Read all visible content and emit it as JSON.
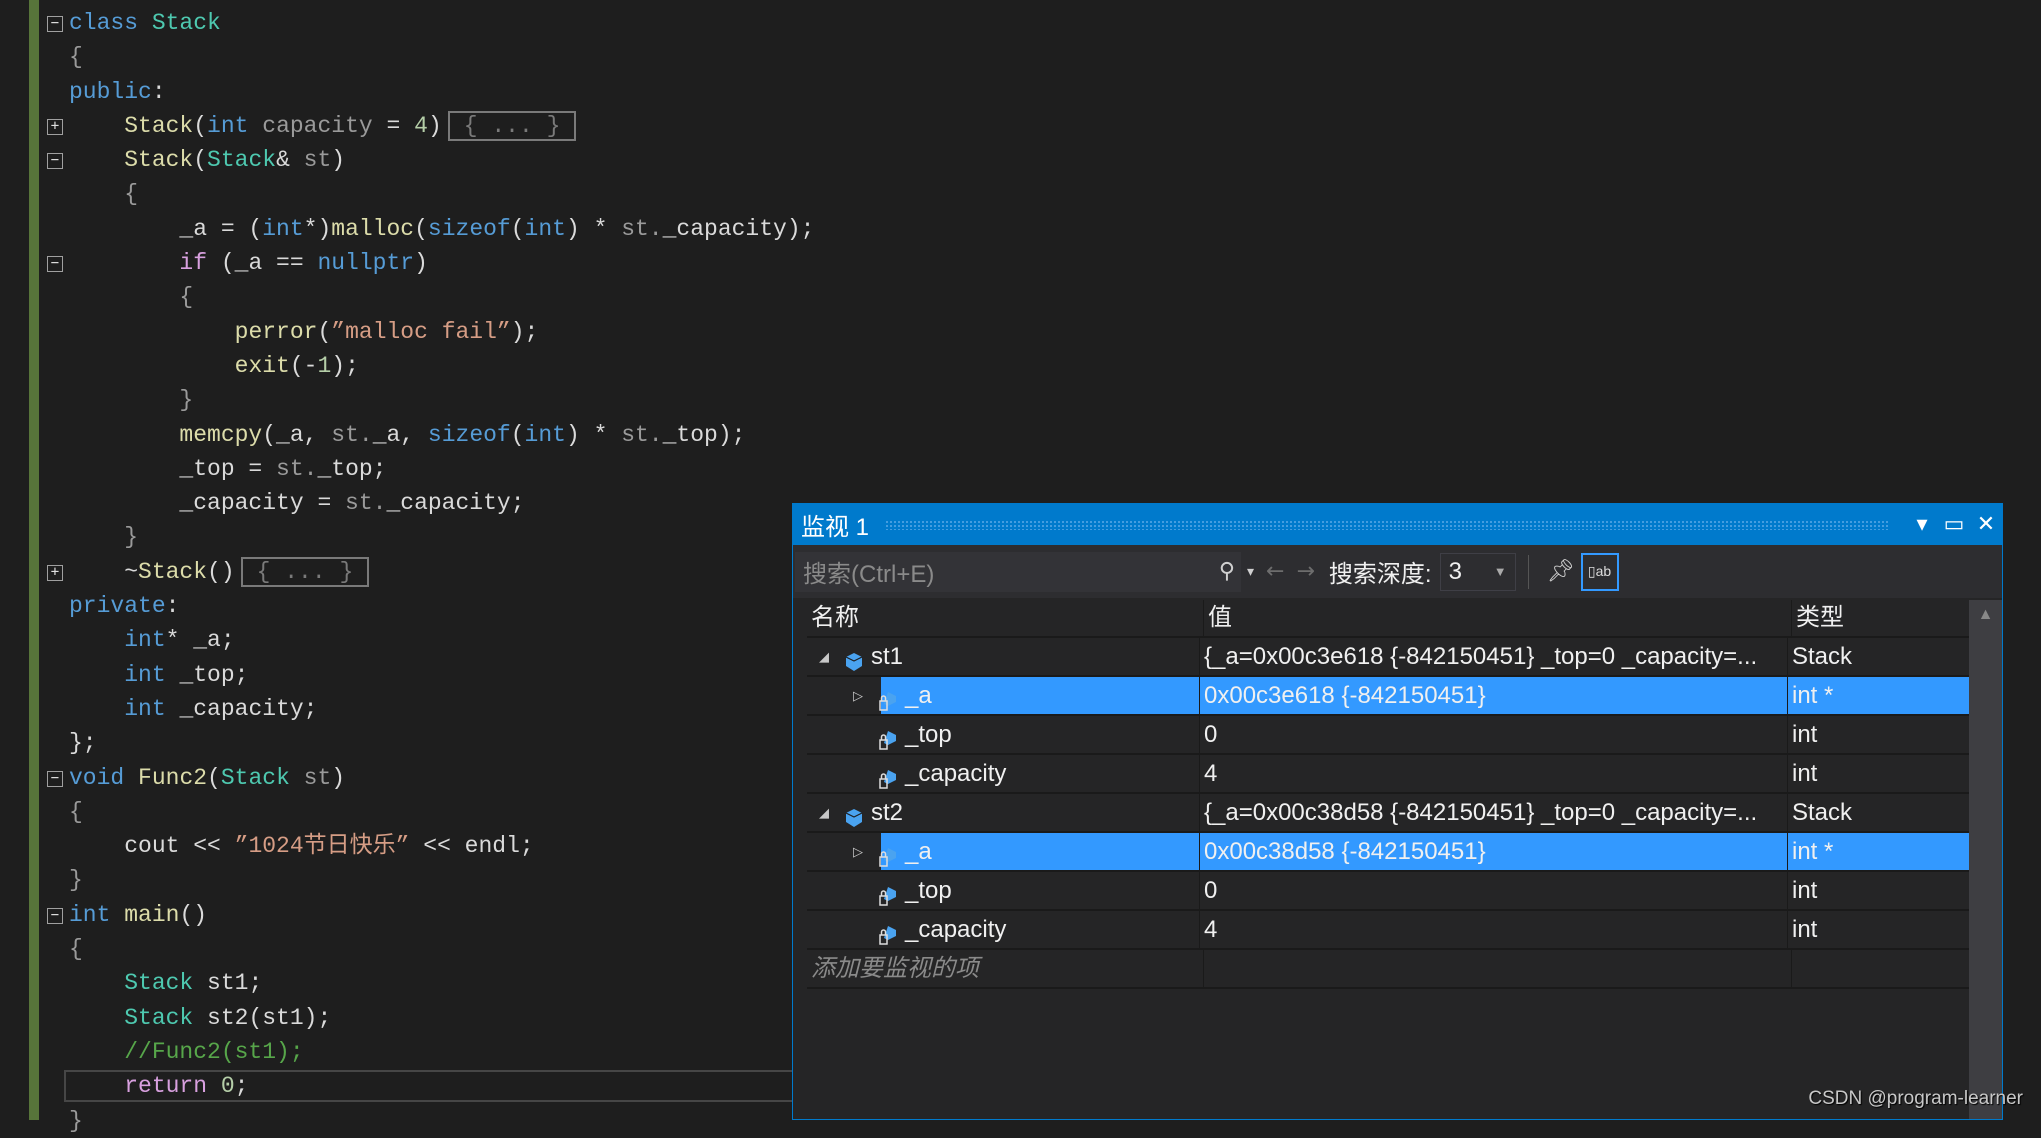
{
  "editor": {
    "lines": [
      {
        "fold": "minus",
        "tokens": [
          [
            "class",
            "kw"
          ],
          [
            " "
          ],
          [
            "Stack",
            "ty"
          ]
        ]
      },
      {
        "tokens": [
          [
            "{",
            "pm"
          ]
        ]
      },
      {
        "tokens": [
          [
            "public",
            "kw"
          ],
          [
            ":"
          ]
        ]
      },
      {
        "fold": "plus",
        "tokens": [
          [
            "    "
          ],
          [
            "Stack",
            "fn"
          ],
          [
            "("
          ],
          [
            "int",
            "kw"
          ],
          [
            " capacity",
            "pm"
          ],
          [
            " = "
          ],
          [
            "4",
            "nm"
          ],
          [
            ")"
          ]
        ],
        "collapsed": "{ ... }"
      },
      {
        "fold": "minus",
        "tokens": [
          [
            "    "
          ],
          [
            "Stack",
            "fn"
          ],
          [
            "("
          ],
          [
            "Stack",
            "ty"
          ],
          [
            "&"
          ],
          [
            " st",
            "pm"
          ],
          [
            ")"
          ]
        ]
      },
      {
        "tokens": [
          [
            "    {",
            "pm"
          ]
        ]
      },
      {
        "tokens": [
          [
            "        _a = ("
          ],
          [
            "int",
            "kw"
          ],
          [
            "*)"
          ],
          [
            "malloc",
            "fn"
          ],
          [
            "("
          ],
          [
            "sizeof",
            "kw"
          ],
          [
            "("
          ],
          [
            "int",
            "kw"
          ],
          [
            ") * "
          ],
          [
            "st.",
            "pm"
          ],
          [
            "_capacity);"
          ]
        ]
      },
      {
        "fold": "minus",
        "tokens": [
          [
            "        "
          ],
          [
            "if",
            "ct"
          ],
          [
            " (_a == "
          ],
          [
            "nullptr",
            "kw"
          ],
          [
            ")"
          ]
        ]
      },
      {
        "tokens": [
          [
            "        {",
            "pm"
          ]
        ]
      },
      {
        "tokens": [
          [
            "            "
          ],
          [
            "perror",
            "fn"
          ],
          [
            "("
          ],
          [
            "”malloc fail”",
            "st"
          ],
          [
            ");"
          ]
        ]
      },
      {
        "tokens": [
          [
            "            "
          ],
          [
            "exit",
            "fn"
          ],
          [
            "(-"
          ],
          [
            "1",
            "nm"
          ],
          [
            ");"
          ]
        ]
      },
      {
        "tokens": [
          [
            "        }",
            "pm"
          ]
        ]
      },
      {
        "tokens": [
          [
            "        "
          ],
          [
            "memcpy",
            "fn"
          ],
          [
            "(_a, "
          ],
          [
            "st.",
            "pm"
          ],
          [
            "_a, "
          ],
          [
            "sizeof",
            "kw"
          ],
          [
            "("
          ],
          [
            "int",
            "kw"
          ],
          [
            ") * "
          ],
          [
            "st.",
            "pm"
          ],
          [
            "_top);"
          ]
        ]
      },
      {
        "tokens": [
          [
            "        _top = "
          ],
          [
            "st.",
            "pm"
          ],
          [
            "_top;"
          ]
        ]
      },
      {
        "tokens": [
          [
            "        _capacity = "
          ],
          [
            "st.",
            "pm"
          ],
          [
            "_capacity;"
          ]
        ]
      },
      {
        "tokens": [
          [
            "    }",
            "pm"
          ]
        ]
      },
      {
        "fold": "plus",
        "tokens": [
          [
            "    ~"
          ],
          [
            "Stack",
            "fn"
          ],
          [
            "()"
          ]
        ],
        "collapsed": "{ ... }"
      },
      {
        "tokens": [
          [
            "private",
            "kw"
          ],
          [
            ":"
          ]
        ]
      },
      {
        "tokens": [
          [
            "    "
          ],
          [
            "int",
            "kw"
          ],
          [
            "* _a;"
          ]
        ]
      },
      {
        "tokens": [
          [
            "    "
          ],
          [
            "int",
            "kw"
          ],
          [
            " _top;"
          ]
        ]
      },
      {
        "tokens": [
          [
            "    "
          ],
          [
            "int",
            "kw"
          ],
          [
            " _capacity;"
          ]
        ]
      },
      {
        "tokens": [
          [
            "};"
          ]
        ]
      },
      {
        "fold": "minus",
        "tokens": [
          [
            "void",
            "kw"
          ],
          [
            " "
          ],
          [
            "Func2",
            "fn"
          ],
          [
            "("
          ],
          [
            "Stack",
            "ty"
          ],
          [
            " st",
            "pm"
          ],
          [
            ")"
          ]
        ]
      },
      {
        "tokens": [
          [
            "{",
            "pm"
          ]
        ]
      },
      {
        "tokens": [
          [
            "    cout << "
          ],
          [
            "”1024节日快乐”",
            "st"
          ],
          [
            " << endl;"
          ]
        ]
      },
      {
        "tokens": [
          [
            "}",
            "pm"
          ]
        ]
      },
      {
        "fold": "minus",
        "tokens": [
          [
            "int",
            "kw"
          ],
          [
            " "
          ],
          [
            "main",
            "fn"
          ],
          [
            "()"
          ]
        ]
      },
      {
        "tokens": [
          [
            "{",
            "pm"
          ]
        ]
      },
      {
        "tokens": [
          [
            "    "
          ],
          [
            "Stack",
            "ty"
          ],
          [
            " st1;"
          ]
        ]
      },
      {
        "tokens": [
          [
            "    "
          ],
          [
            "Stack",
            "ty"
          ],
          [
            " st2(st1);"
          ]
        ]
      },
      {
        "tokens": [
          [
            "    //Func2(st1);",
            "cm"
          ]
        ]
      },
      {
        "current": true,
        "tokens": [
          [
            "    "
          ],
          [
            "return",
            "ct"
          ],
          [
            " "
          ],
          [
            "0",
            "nm"
          ],
          [
            ";"
          ]
        ]
      },
      {
        "tokens": [
          [
            "}",
            "pm"
          ]
        ]
      }
    ]
  },
  "watch": {
    "title": "监视 1",
    "search_placeholder": "搜索(Ctrl+E)",
    "depth_label": "搜索深度:",
    "depth_value": "3",
    "columns": [
      "名称",
      "值",
      "类型"
    ],
    "rows": [
      {
        "level": 0,
        "expander": "expanded",
        "name": "st1",
        "value": "{_a=0x00c3e618 {-842150451} _top=0 _capacity=...",
        "type": "Stack",
        "selected": false
      },
      {
        "level": 1,
        "expander": "collapsed",
        "name": "_a",
        "value": "0x00c3e618 {-842150451}",
        "type": "int *",
        "selected": true
      },
      {
        "level": 1,
        "expander": "none",
        "name": "_top",
        "value": "0",
        "type": "int",
        "selected": false
      },
      {
        "level": 1,
        "expander": "none",
        "name": "_capacity",
        "value": "4",
        "type": "int",
        "selected": false
      },
      {
        "level": 0,
        "expander": "expanded",
        "name": "st2",
        "value": "{_a=0x00c38d58 {-842150451} _top=0 _capacity=...",
        "type": "Stack",
        "selected": false
      },
      {
        "level": 1,
        "expander": "collapsed",
        "name": "_a",
        "value": "0x00c38d58 {-842150451}",
        "type": "int *",
        "selected": true
      },
      {
        "level": 1,
        "expander": "none",
        "name": "_top",
        "value": "0",
        "type": "int",
        "selected": false
      },
      {
        "level": 1,
        "expander": "none",
        "name": "_capacity",
        "value": "4",
        "type": "int",
        "selected": false
      }
    ],
    "add_item_placeholder": "添加要监视的项"
  },
  "watermark": "CSDN @program-learner",
  "colors": {
    "accent": "#007acc",
    "selection": "#3399ff",
    "background": "#1e1e1e"
  }
}
